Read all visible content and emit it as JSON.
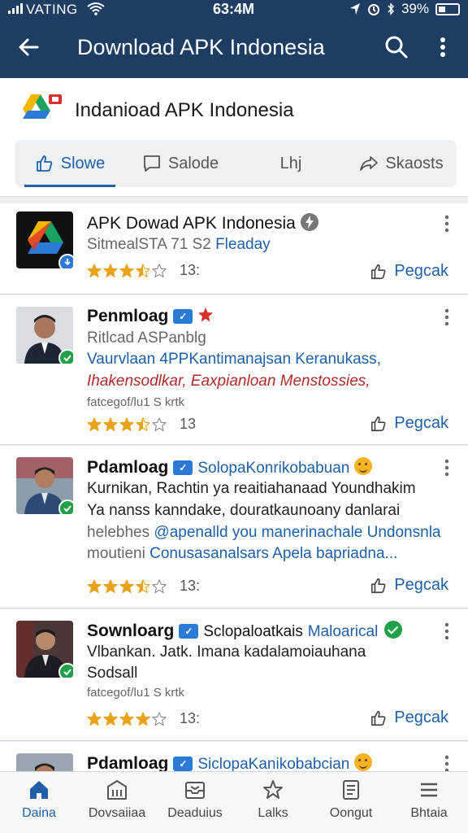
{
  "status": {
    "carrier": "VATING",
    "time": "63:4M",
    "battery": "39%"
  },
  "app_bar": {
    "title": "Download APK Indonesia"
  },
  "header": {
    "title": "Indanioad APK Indonesia",
    "tabs": [
      {
        "label": "Slowe",
        "icon": "thumb-up-icon"
      },
      {
        "label": "Salode",
        "icon": "comment-icon"
      },
      {
        "label": "Lhj",
        "icon": "text-icon"
      },
      {
        "label": "Skaosts",
        "icon": "share-icon"
      }
    ]
  },
  "posts": [
    {
      "title": "APK Dowad APK Indonesia",
      "sub": "SitmealSTA 71 S2",
      "sub_link": "Fleaday",
      "rating": 3.5,
      "count": "13:",
      "action": "Pegcak"
    },
    {
      "title": "Penmloag",
      "sub": "Ritlcad ASPanblg",
      "line_blue": "Vaurvlaan 4PPKantimanajsan Keranukass,",
      "line_red": "Ihakensodlkar, Eaxpianloan Menstossies,",
      "line_small": "fatcegof/lu1 S krtk",
      "rating": 3.5,
      "count": "13",
      "action": "Pegcak"
    },
    {
      "title": "Pdamloag",
      "sub_link": "SolopaKonrikobabuan",
      "line1": "Kurnikan, Rachtin ya reaitiahanaad Youndhakim",
      "line2": "Ya nanss kanndake, douratkaunoany danlarai",
      "line3_prefix": "helebhes",
      "line3_link": "@apenalld you manerinachale Undonsnla",
      "line4_prefix": "moutieni",
      "line4_link": "Conusasanalsars Apela bapriadna...",
      "rating": 3.5,
      "count": "13:",
      "action": "Pegcak"
    },
    {
      "title": "Sownloarg",
      "sub": "Sclopaloatkais",
      "sub_link": "Maloarical",
      "line1": "Vlbankan. Jatk. Imana kadalamoiauhana",
      "line2": "Sodsall",
      "line_small": "fatcegof/lu1 S krtk",
      "rating": 4,
      "count": "13:",
      "action": "Pegcak"
    },
    {
      "title": "Pdamloag",
      "sub_link": "SiclopaKanikobabcian"
    }
  ],
  "bottom_nav": [
    {
      "label": "Daina",
      "icon": "home-icon"
    },
    {
      "label": "Dovsaiiaa",
      "icon": "bank-icon"
    },
    {
      "label": "Deaduius",
      "icon": "inbox-icon"
    },
    {
      "label": "Lalks",
      "icon": "star-icon"
    },
    {
      "label": "Oongut",
      "icon": "document-icon"
    },
    {
      "label": "Bhtaia",
      "icon": "menu-icon"
    }
  ],
  "colors": {
    "primary": "#1e3d63",
    "accent": "#1f5fa8",
    "star": "#e8a31a",
    "verified": "#21a04a"
  }
}
